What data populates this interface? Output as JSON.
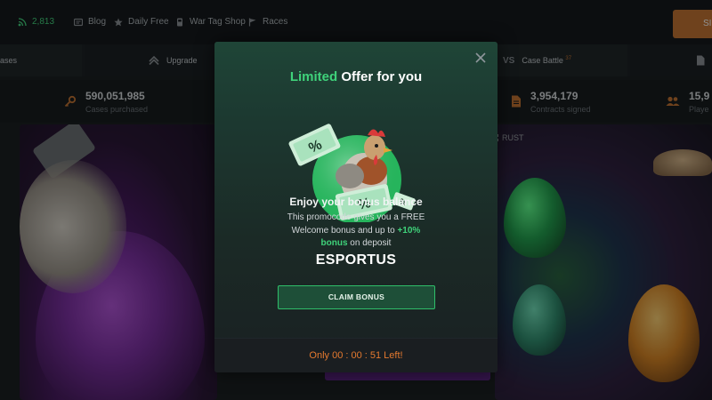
{
  "topbar": {
    "online_count": "2,813",
    "links": [
      "Blog",
      "Daily Free",
      "War Tag Shop",
      "Races"
    ],
    "icons": [
      "signal-icon",
      "blog-icon",
      "star-icon",
      "shop-icon",
      "flag-icon"
    ],
    "cta_label": "SI"
  },
  "nav": {
    "items": [
      {
        "label": "ases"
      },
      {
        "label": "Upgrade"
      },
      {
        "label": "Case Battle",
        "badge": "37"
      }
    ]
  },
  "stats": [
    {
      "value": "590,051,985",
      "label": "Cases purchased"
    },
    {
      "value": "3,954,179",
      "label": "Contracts signed"
    },
    {
      "value": "15,9",
      "label": "Playe"
    }
  ],
  "cards": {
    "rust_label": "RUST"
  },
  "modal": {
    "title_highlight": "Limited",
    "title_rest": "Offer for you",
    "heading": "Enjoy your bonus balance",
    "desc_line1": "This promocode gives you a FREE",
    "desc_line2_a": "Welcome bonus and up to ",
    "desc_line2_b": "+10%",
    "desc_line3_a": "bonus",
    "desc_line3_b": " on deposit",
    "promo_code": "ESPORTUS",
    "claim_label": "CLAIM BONUS",
    "timer_text": "Only 00 : 00 : 51 Left!"
  },
  "colors": {
    "accent_green": "#3fd27a",
    "accent_orange": "#e4792f",
    "modal_bg": "#1c3830",
    "button_bg": "#1e4f38"
  }
}
